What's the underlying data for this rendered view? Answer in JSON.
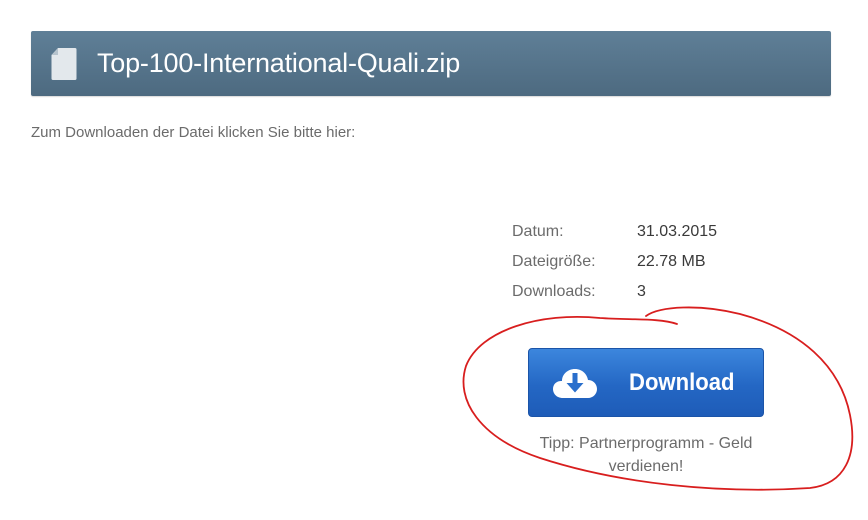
{
  "file": {
    "icon": "file-icon",
    "title": "Top-100-International-Quali.zip"
  },
  "instruction": "Zum Downloaden der Datei klicken Sie bitte hier:",
  "meta": [
    {
      "label": "Datum:",
      "value": "31.03.2015"
    },
    {
      "label": "Dateigröße:",
      "value": "22.78 MB"
    },
    {
      "label": "Downloads:",
      "value": "3"
    }
  ],
  "download": {
    "icon": "cloud-download-icon",
    "label": "Download"
  },
  "tip": "Tipp: Partnerprogramm - Geld verdienen!",
  "colors": {
    "header_bg": "#56768d",
    "button_bg": "#2a6fcc",
    "annotation": "#d81e1e"
  }
}
